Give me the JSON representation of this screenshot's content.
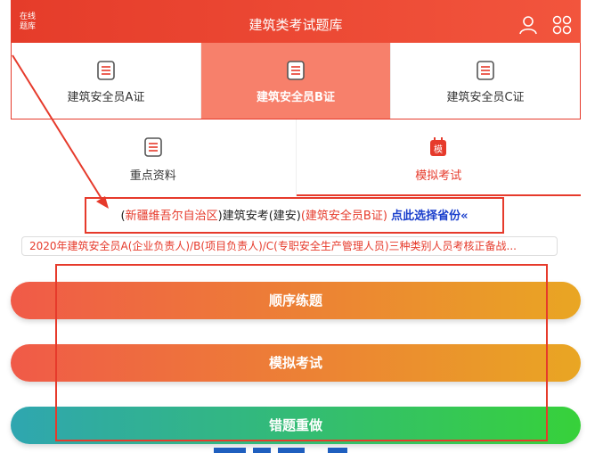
{
  "header": {
    "logo_line1": "在线",
    "logo_line2": "题库",
    "title": "建筑类考试题库"
  },
  "tabs_row1": [
    {
      "label": "建筑安全员A证",
      "active": false
    },
    {
      "label": "建筑安全员B证",
      "active": true
    },
    {
      "label": "建筑安全员C证",
      "active": false
    }
  ],
  "tabs_row2": [
    {
      "label": "重点资料",
      "active": false
    },
    {
      "label": "模拟考试",
      "active": true,
      "icon_text": "模"
    }
  ],
  "region": {
    "open_paren": "(",
    "province": "新疆维吾尔自治区",
    "close_paren": ")",
    "middle": "建筑安考(建安)",
    "cert": "(建筑安全员B证)",
    "select_link": "点此选择省份«"
  },
  "notice": {
    "text": "2020年建筑安全员A(企业负责人)/B(项目负责人)/C(专职安全生产管理人员)三种类别人员考核正备战..."
  },
  "buttons": {
    "sequential": "顺序练题",
    "mock": "模拟考试",
    "wrong": "错题重做"
  },
  "colors": {
    "brand_red": "#e63a2b",
    "active_tab": "#f7806b",
    "link_blue": "#1a3fcc",
    "btn_orange_start": "#f05a48",
    "btn_orange_end": "#e9a623",
    "btn_green_start": "#2fa6b0",
    "btn_green_end": "#37d13a"
  }
}
